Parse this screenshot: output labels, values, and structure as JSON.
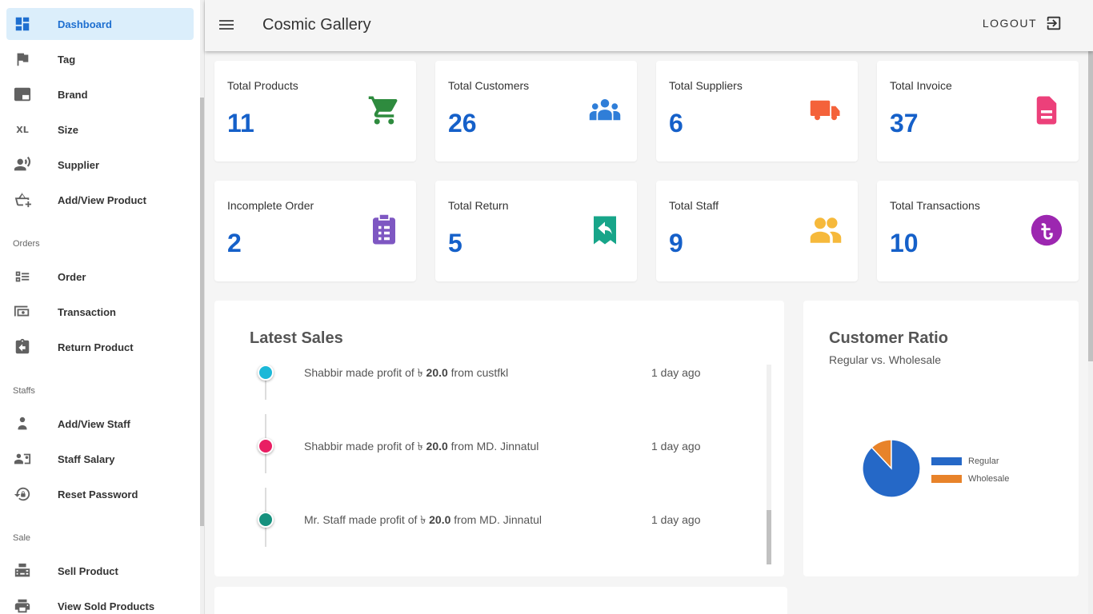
{
  "app": {
    "title": "Cosmic Gallery",
    "logout_label": "LOGOUT"
  },
  "sidebar": {
    "items": [
      {
        "label": "Dashboard",
        "icon": "dashboard-icon"
      },
      {
        "label": "Tag",
        "icon": "flag-icon"
      },
      {
        "label": "Brand",
        "icon": "brand-icon"
      },
      {
        "label": "Size",
        "icon": "size-xl-icon",
        "icon_text": "XL"
      },
      {
        "label": "Supplier",
        "icon": "supplier-icon"
      },
      {
        "label": "Add/View Product",
        "icon": "add-basket-icon"
      },
      {
        "label": "Order",
        "icon": "checklist-icon"
      },
      {
        "label": "Transaction",
        "icon": "money-icon"
      },
      {
        "label": "Return Product",
        "icon": "return-icon"
      },
      {
        "label": "Add/View Staff",
        "icon": "person-icon"
      },
      {
        "label": "Staff Salary",
        "icon": "salary-icon"
      },
      {
        "label": "Reset Password",
        "icon": "lock-reset-icon"
      },
      {
        "label": "Sell Product",
        "icon": "register-icon"
      },
      {
        "label": "View Sold Products",
        "icon": "print-view-icon"
      }
    ],
    "sections": {
      "orders": "Orders",
      "staffs": "Staffs",
      "sale": "Sale"
    }
  },
  "stats": [
    {
      "title": "Total Products",
      "value": "11",
      "icon": "cart-icon",
      "color": "#2e8b3e"
    },
    {
      "title": "Total Customers",
      "value": "26",
      "icon": "customers-icon",
      "color": "#2f7ed8"
    },
    {
      "title": "Total Suppliers",
      "value": "6",
      "icon": "truck-icon",
      "color": "#f4623a"
    },
    {
      "title": "Total Invoice",
      "value": "37",
      "icon": "invoice-icon",
      "color": "#ec407a"
    },
    {
      "title": "Incomplete Order",
      "value": "2",
      "icon": "clipboard-icon",
      "color": "#7e57c2"
    },
    {
      "title": "Total Return",
      "value": "5",
      "icon": "return-ticket-icon",
      "color": "#17a589"
    },
    {
      "title": "Total Staff",
      "value": "9",
      "icon": "staff-icon",
      "color": "#f6b93b"
    },
    {
      "title": "Total Transactions",
      "value": "10",
      "icon": "taka-icon",
      "color": "#9c27b0"
    }
  ],
  "latest_sales": {
    "title": "Latest Sales",
    "items": [
      {
        "who": "Shabbir",
        "verb": "made profit of",
        "currency": "৳",
        "amount": "20.0",
        "from_word": "from",
        "customer": "custfkl",
        "time": "1 day ago",
        "dot_color": "#1cb8d8"
      },
      {
        "who": "Shabbir",
        "verb": "made profit of",
        "currency": "৳",
        "amount": "20.0",
        "from_word": "from",
        "customer": "MD. Jinnatul",
        "time": "1 day ago",
        "dot_color": "#e91e63"
      },
      {
        "who": "Mr. Staff",
        "verb": "made profit of",
        "currency": "৳",
        "amount": "20.0",
        "from_word": "from",
        "customer": "MD. Jinnatul",
        "time": "1 day ago",
        "dot_color": "#16917e"
      }
    ]
  },
  "customer_ratio": {
    "title": "Customer Ratio",
    "subtitle": "Regular vs. Wholesale",
    "chart_data": {
      "type": "pie",
      "categories": [
        "Regular",
        "Wholesale"
      ],
      "values": [
        88,
        12
      ],
      "colors": [
        "#2568c7",
        "#e8832a"
      ],
      "legend_position": "right"
    }
  }
}
